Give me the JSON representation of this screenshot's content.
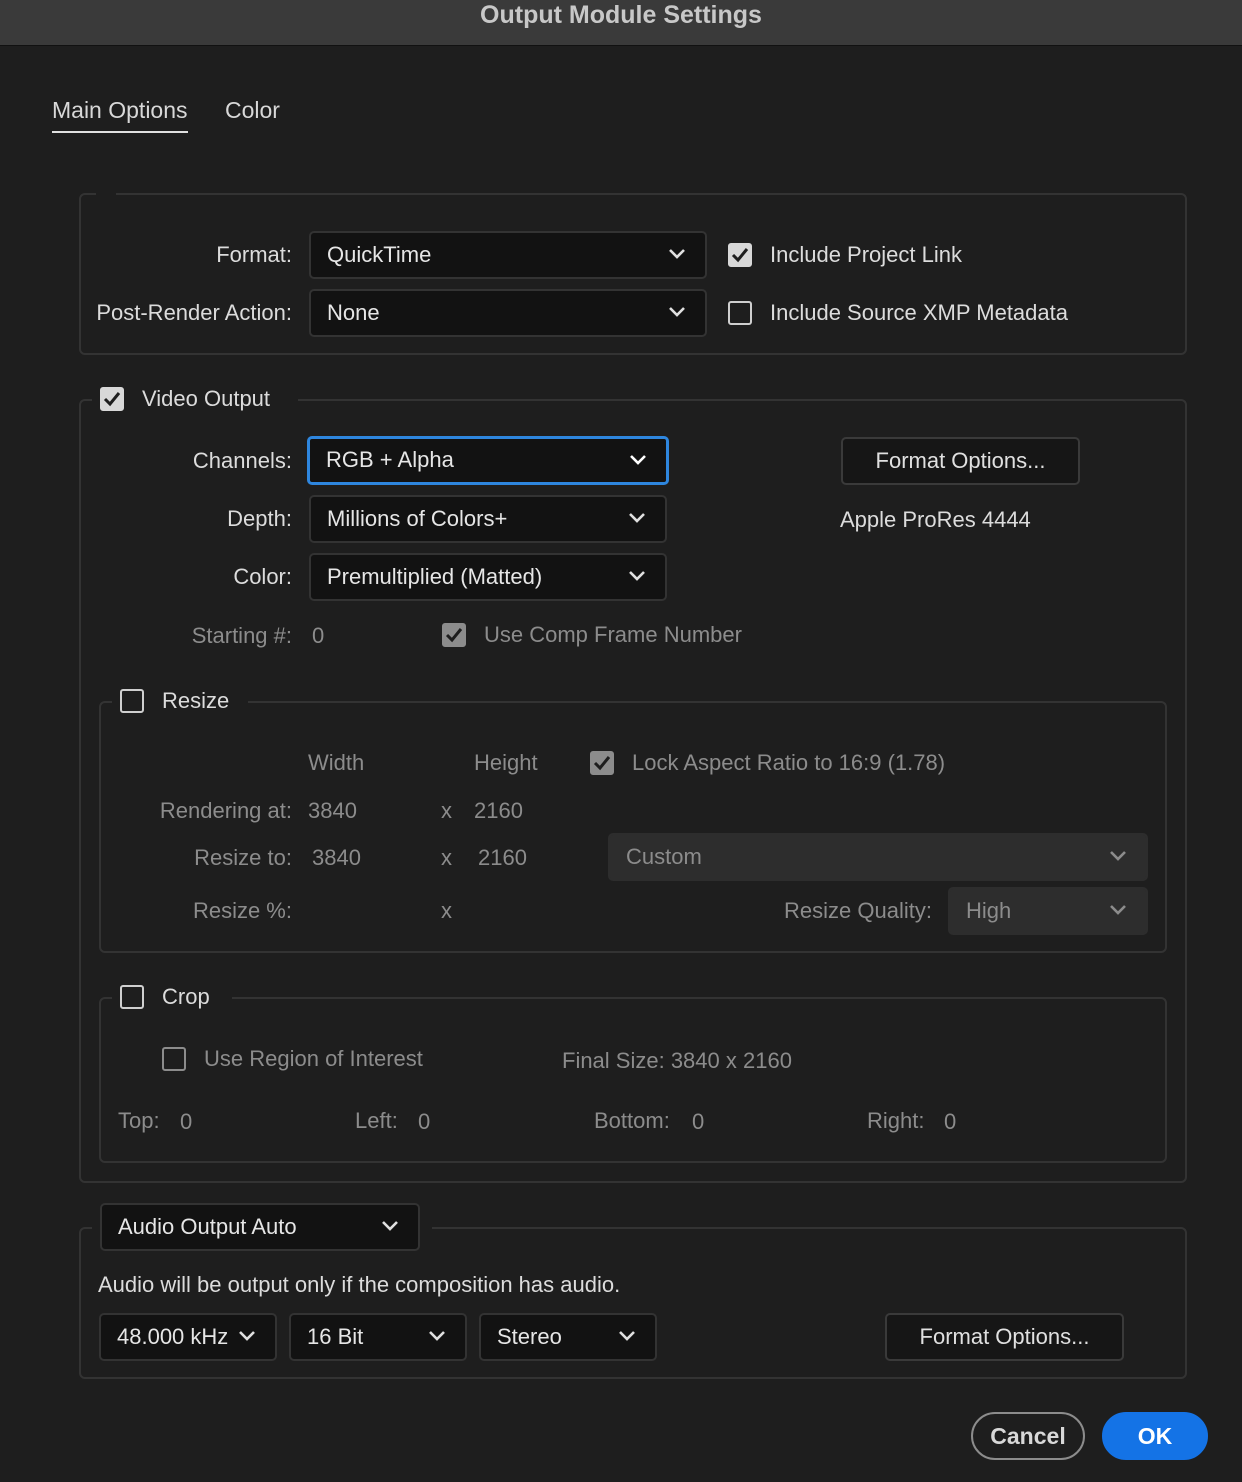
{
  "window": {
    "title": "Output Module Settings"
  },
  "tabs": [
    {
      "label": "Main Options",
      "active": true
    },
    {
      "label": "Color",
      "active": false
    }
  ],
  "format": {
    "label": "Format:",
    "value": "QuickTime",
    "post_render_label": "Post-Render Action:",
    "post_render_value": "None",
    "include_project_link": {
      "label": "Include Project Link",
      "checked": true
    },
    "include_xmp": {
      "label": "Include Source XMP Metadata",
      "checked": false
    }
  },
  "video": {
    "label": "Video Output",
    "checked": true,
    "channels_label": "Channels:",
    "channels_value": "RGB + Alpha",
    "depth_label": "Depth:",
    "depth_value": "Millions of Colors+",
    "color_label": "Color:",
    "color_value": "Premultiplied (Matted)",
    "starting_label": "Starting #:",
    "starting_value": "0",
    "use_comp_frame": {
      "label": "Use Comp Frame Number",
      "checked": true
    },
    "format_options_label": "Format Options...",
    "codec": "Apple ProRes 4444"
  },
  "resize": {
    "label": "Resize",
    "checked": false,
    "width_header": "Width",
    "height_header": "Height",
    "lock_aspect": {
      "label": "Lock Aspect Ratio to 16:9 (1.78)",
      "checked": true
    },
    "rendering_label": "Rendering at:",
    "rendering_w": "3840",
    "rendering_h": "2160",
    "resize_to_label": "Resize to:",
    "resize_w": "3840",
    "resize_h": "2160",
    "x": "x",
    "preset": "Custom",
    "percent_label": "Resize %:",
    "quality_label": "Resize Quality:",
    "quality_value": "High"
  },
  "crop": {
    "label": "Crop",
    "checked": false,
    "roi": {
      "label": "Use Region of Interest",
      "checked": false
    },
    "final_size": "Final Size: 3840 x 2160",
    "top_label": "Top:",
    "top_value": "0",
    "left_label": "Left:",
    "left_value": "0",
    "bottom_label": "Bottom:",
    "bottom_value": "0",
    "right_label": "Right:",
    "right_value": "0"
  },
  "audio": {
    "mode": "Audio Output Auto",
    "note": "Audio will be output only if the composition has audio.",
    "rate": "48.000 kHz",
    "bits": "16 Bit",
    "channels": "Stereo",
    "format_options_label": "Format Options..."
  },
  "buttons": {
    "cancel": "Cancel",
    "ok": "OK"
  }
}
